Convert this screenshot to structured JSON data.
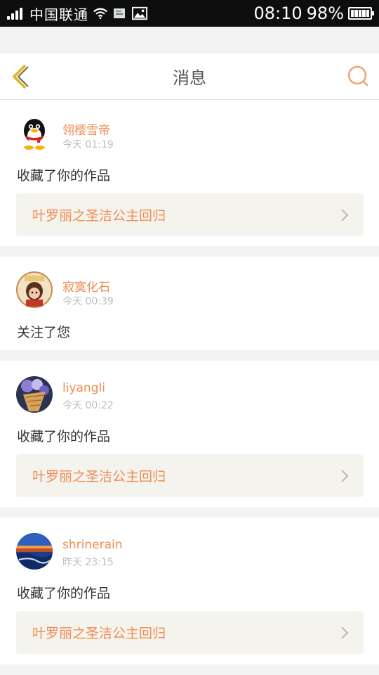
{
  "status_bar": {
    "carrier": "中国联通",
    "time": "08:10",
    "battery": "98%"
  },
  "header": {
    "title": "消息",
    "back_icon": "chevron-left-icon",
    "search_icon": "search-icon"
  },
  "accent_color": "#f08c52",
  "messages": [
    {
      "user": "翎樱雪帝",
      "time": "今天 01:19",
      "action": "收藏了你的作品",
      "work": "叶罗丽之圣洁公主回归"
    },
    {
      "user": "寂寞化石",
      "time": "今天 00:39",
      "action": "关注了您",
      "work": ""
    },
    {
      "user": "liyangli",
      "time": "今天 00:22",
      "action": "收藏了你的作品",
      "work": "叶罗丽之圣洁公主回归"
    },
    {
      "user": "shrinerain",
      "time": "昨天 23:15",
      "action": "收藏了你的作品",
      "work": "叶罗丽之圣洁公主回归"
    }
  ]
}
